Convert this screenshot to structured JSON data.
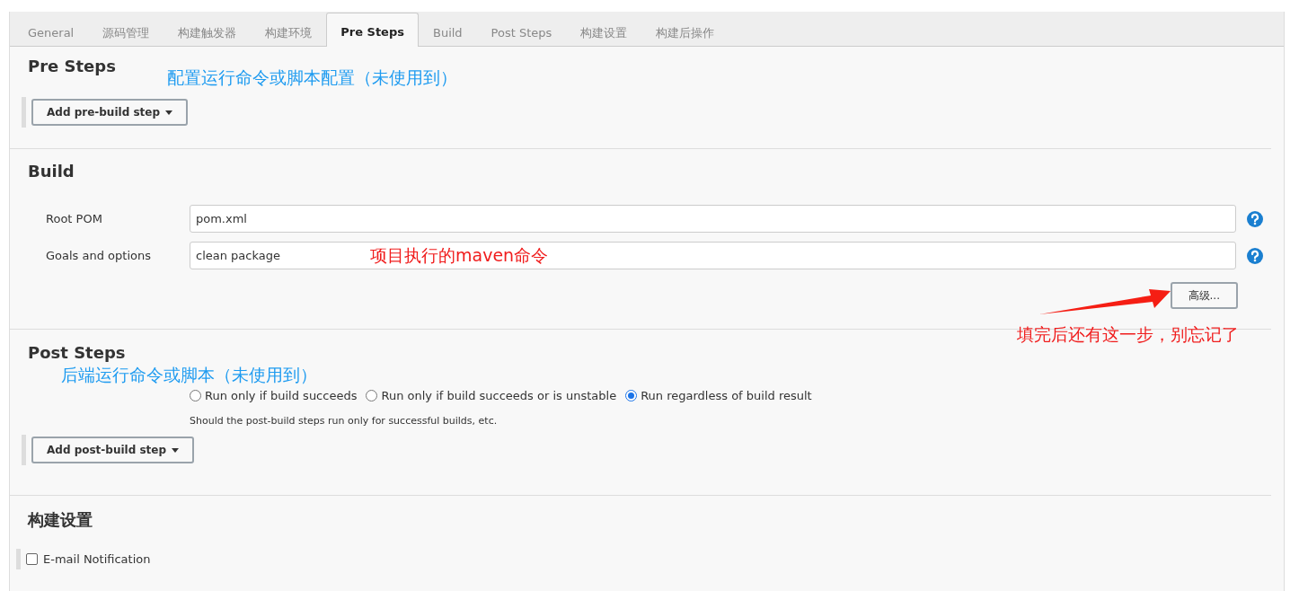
{
  "tabs": [
    {
      "label": "General",
      "selected": false
    },
    {
      "label": "源码管理",
      "selected": false
    },
    {
      "label": "构建触发器",
      "selected": false
    },
    {
      "label": "构建环境",
      "selected": false
    },
    {
      "label": "Pre Steps",
      "selected": true
    },
    {
      "label": "Build",
      "selected": false
    },
    {
      "label": "Post Steps",
      "selected": false
    },
    {
      "label": "构建设置",
      "selected": false
    },
    {
      "label": "构建后操作",
      "selected": false
    }
  ],
  "pre_steps": {
    "title": "Pre Steps",
    "annotation": "配置运行命令或脚本配置（未使用到）",
    "add_button": "Add pre-build step"
  },
  "build": {
    "title": "Build",
    "fields": [
      {
        "label": "Root POM",
        "value": "pom.xml"
      },
      {
        "label": "Goals and options",
        "value": "clean package",
        "annotation": "项目执行的maven命令"
      }
    ],
    "advanced_button": "高级...",
    "annotation": "填完后还有这一步，别忘记了"
  },
  "post_steps": {
    "title": "Post Steps",
    "annotation": "后端运行命令或脚本（未使用到）",
    "options": [
      {
        "label": "Run only if build succeeds",
        "selected": false
      },
      {
        "label": "Run only if build succeeds or is unstable",
        "selected": false
      },
      {
        "label": "Run regardless of build result",
        "selected": true
      }
    ],
    "description": "Should the post-build steps run only for successful builds, etc.",
    "add_button": "Add post-build step"
  },
  "build_settings": {
    "title": "构建设置",
    "email_notification": {
      "label": "E-mail Notification",
      "checked": false
    }
  }
}
